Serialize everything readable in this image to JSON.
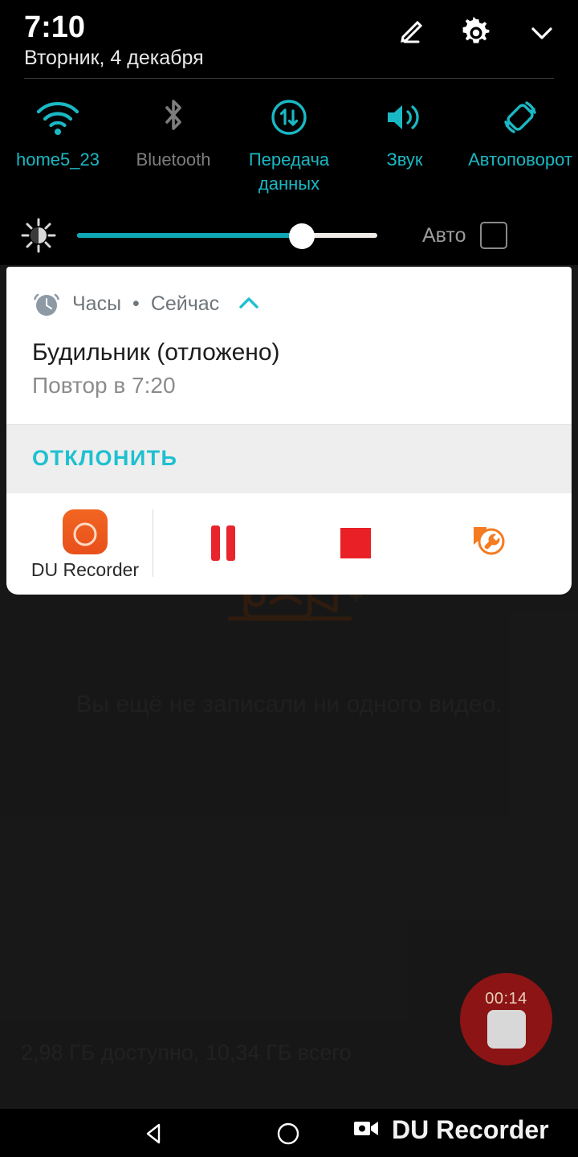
{
  "status": {
    "time": "7:10",
    "date": "Вторник, 4 декабря",
    "icons": {
      "edit": "edit-pencil-icon",
      "settings": "gear-icon",
      "collapse": "chevron-down-icon"
    }
  },
  "quick_settings": {
    "tiles": [
      {
        "label": "home5_23",
        "icon": "wifi-icon",
        "state": "active"
      },
      {
        "label": "Bluetooth",
        "icon": "bluetooth-icon",
        "state": "inactive"
      },
      {
        "label": "Передача данных",
        "icon": "data-transfer-icon",
        "state": "active"
      },
      {
        "label": "Звук",
        "icon": "volume-icon",
        "state": "active"
      },
      {
        "label": "Автоповорот",
        "icon": "auto-rotate-icon",
        "state": "active"
      }
    ],
    "brightness": {
      "icon": "brightness-sun-icon",
      "value_percent": 75,
      "auto_label": "Авто",
      "auto_checked": false
    },
    "accent_color": "#1ab8c4"
  },
  "notifications": [
    {
      "app": "Часы",
      "app_icon": "alarm-clock-icon",
      "when": "Сейчас",
      "separator": "•",
      "collapse_icon": "chevron-up-icon",
      "title": "Будильник (отложено)",
      "body": "Повтор в 7:20",
      "action_label": "ОТКЛОНИТЬ",
      "action_color": "#1ec0d0"
    },
    {
      "app": "DU Recorder",
      "app_icon": "du-recorder-icon",
      "actions": [
        {
          "name": "pause",
          "icon": "pause-icon",
          "color": "#e8242c"
        },
        {
          "name": "stop",
          "icon": "stop-icon",
          "color": "#ea2027"
        },
        {
          "name": "tools",
          "icon": "wrench-tools-icon",
          "color": "#f47b20"
        }
      ]
    }
  ],
  "app": {
    "empty_state_text": "Вы ещё не записали ни одного видео.",
    "empty_state_icon": "sad-camcorder-icon",
    "storage_text": "2,98 ГБ доступно, 10,34 ГБ всего",
    "record_button": {
      "timer": "00:14",
      "icon": "stop-square-icon",
      "color": "#8c1414"
    }
  },
  "navbar": {
    "back_icon": "back-triangle-icon",
    "home_icon": "home-circle-icon",
    "watermark_icon": "video-camera-icon",
    "watermark_text": "DU Recorder"
  }
}
